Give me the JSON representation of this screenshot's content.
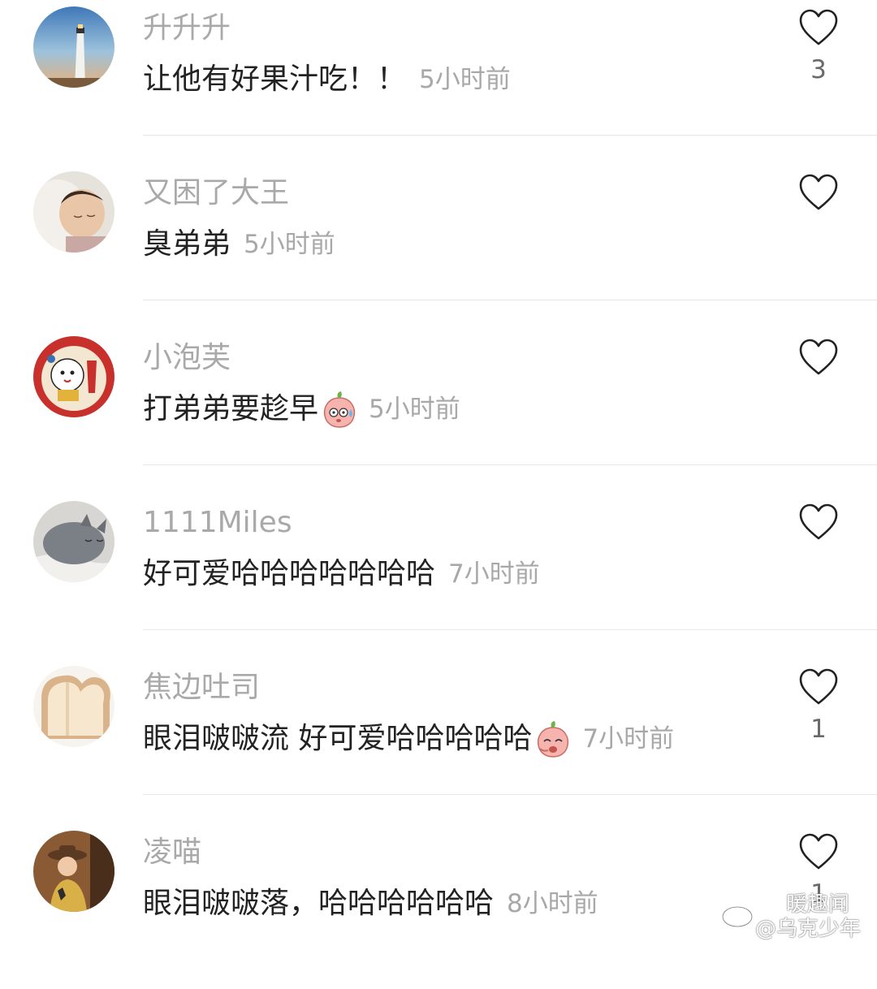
{
  "comments": [
    {
      "username": "升升升",
      "text": "让他有好果汁吃！！",
      "time": "5小时前",
      "emoji": "",
      "like_count": "3",
      "avatar": "lighthouse-avatar"
    },
    {
      "username": "又困了大王",
      "text": "臭弟弟",
      "time": "5小时前",
      "emoji": "",
      "like_count": "",
      "avatar": "sleeping-baby-avatar"
    },
    {
      "username": "小泡芙",
      "text": "打弟弟要趁早",
      "time": "5小时前",
      "emoji": "sweat-peach-emoji",
      "like_count": "",
      "avatar": "lucky-cat-avatar"
    },
    {
      "username": "1111Miles",
      "text": "好可爱哈哈哈哈哈哈哈",
      "time": "7小时前",
      "emoji": "",
      "like_count": "",
      "avatar": "grey-cat-avatar"
    },
    {
      "username": "焦边吐司",
      "text": "眼泪啵啵流 好可爱哈哈哈哈哈",
      "time": "7小时前",
      "emoji": "laugh-peach-emoji",
      "like_count": "1",
      "avatar": "toast-avatar"
    },
    {
      "username": "凌喵",
      "text": "眼泪啵啵落，哈哈哈哈哈哈",
      "time": "8小时前",
      "emoji": "",
      "like_count": "1",
      "avatar": "cowboy-hat-avatar"
    }
  ],
  "watermark": {
    "line1": "暖趣闻",
    "line2": "@乌克少年",
    "icon": "weibo-icon"
  },
  "colors": {
    "username": "#a9a9a9",
    "text": "#222222",
    "time": "#a8a8a8",
    "divider": "#e8e8e8",
    "heart_outline": "#222222"
  }
}
